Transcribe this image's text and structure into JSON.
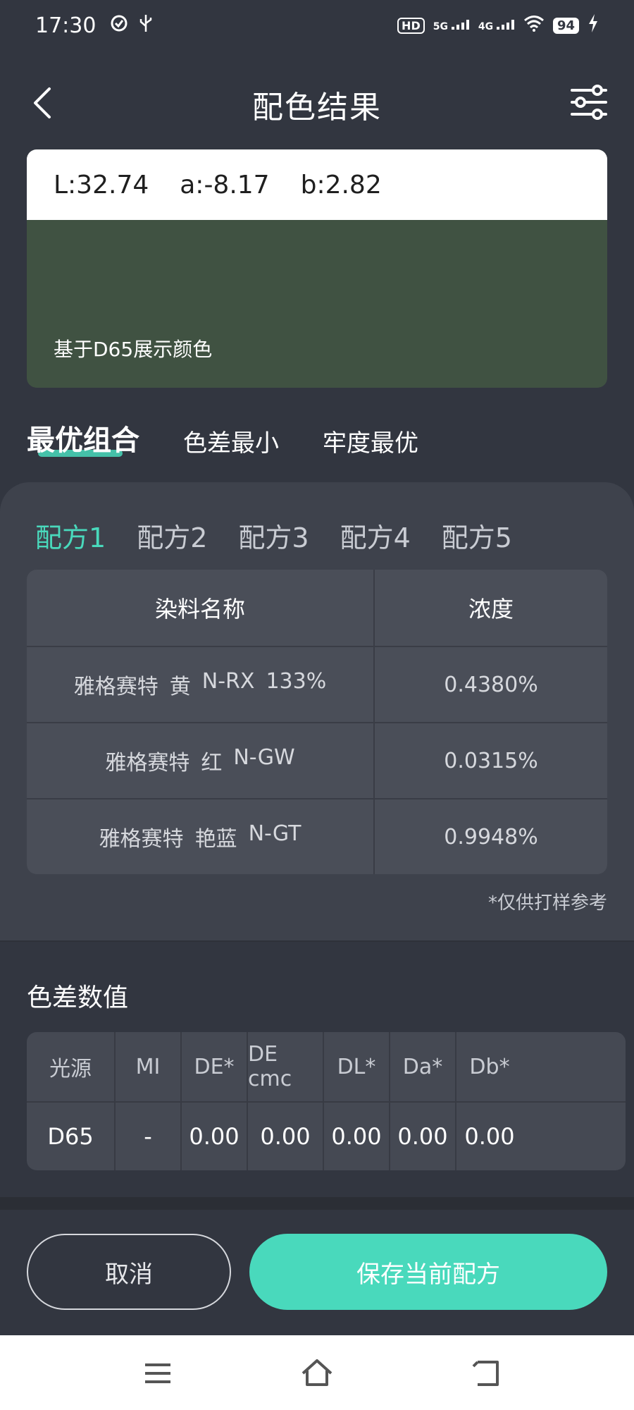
{
  "status_bar": {
    "time": "17:30",
    "hd": "HD",
    "net1": "5G",
    "net2": "4G",
    "battery": "94"
  },
  "app_bar": {
    "title": "配色结果"
  },
  "color_card": {
    "L": "L:32.74",
    "a": "a:-8.17",
    "b": "b:2.82",
    "swatch_color": "#405242",
    "note": "基于D65展示颜色"
  },
  "option_tabs": [
    {
      "label": "最优组合",
      "active": true
    },
    {
      "label": "色差最小",
      "active": false
    },
    {
      "label": "牢度最优",
      "active": false
    }
  ],
  "formula_tabs": [
    {
      "label": "配方1",
      "active": true
    },
    {
      "label": "配方2",
      "active": false
    },
    {
      "label": "配方3",
      "active": false
    },
    {
      "label": "配方4",
      "active": false
    },
    {
      "label": "配方5",
      "active": false
    }
  ],
  "dye_table": {
    "headers": {
      "name": "染料名称",
      "concentration": "浓度"
    },
    "rows": [
      {
        "brand": "雅格赛特",
        "color": "黄",
        "code": "N-RX",
        "extra": "133%",
        "concentration": "0.4380%"
      },
      {
        "brand": "雅格赛特",
        "color": "红",
        "code": "N-GW",
        "extra": "",
        "concentration": "0.0315%"
      },
      {
        "brand": "雅格赛特",
        "color": "艳蓝",
        "code": "N-GT",
        "extra": "",
        "concentration": "0.9948%"
      }
    ],
    "note": "*仅供打样参考"
  },
  "color_diff": {
    "title": "色差数值",
    "headers": [
      "光源",
      "MI",
      "DE*",
      "DE  cmc",
      "DL*",
      "Da*",
      "Db*"
    ],
    "values": [
      "D65",
      "-",
      "0.00",
      "0.00",
      "0.00",
      "0.00",
      "0.00"
    ]
  },
  "buttons": {
    "cancel": "取消",
    "save": "保存当前配方"
  },
  "colors": {
    "accent": "#49d9bc",
    "background": "#323640",
    "panel": "#3e424c"
  }
}
